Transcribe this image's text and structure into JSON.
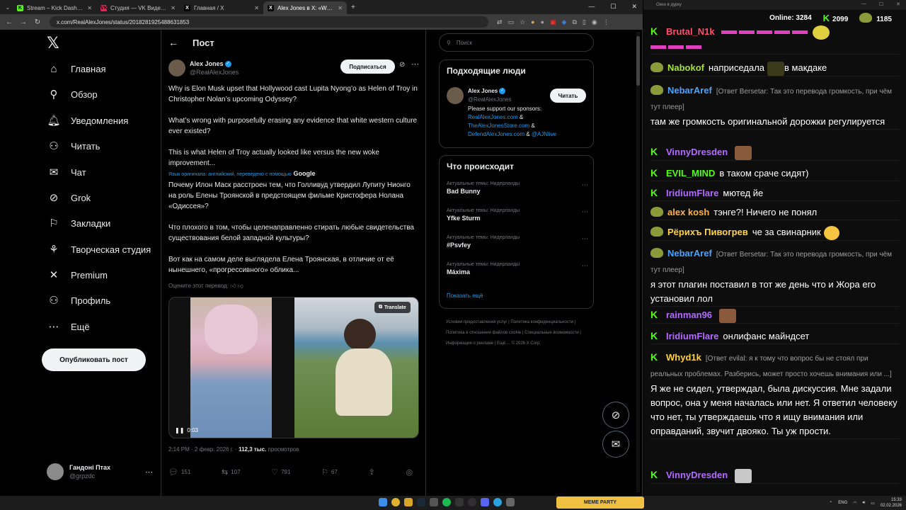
{
  "browser": {
    "tabs": [
      {
        "label": "Stream – Kick Dashboard",
        "fav": "K",
        "favcolor": "#53fc18"
      },
      {
        "label": "Студия — VK Видео Live",
        "fav": "VK",
        "favcolor": "#e0245e"
      },
      {
        "label": "Главная / X",
        "fav": "X",
        "favcolor": "#000000"
      },
      {
        "label": "Alex Jones в X: «Why is Elon M...",
        "fav": "X",
        "favcolor": "#000000"
      }
    ],
    "url": "x.com/RealAlexJones/status/2018281925488631853"
  },
  "nav": {
    "items": [
      {
        "label": "Главная",
        "icon": "⌂"
      },
      {
        "label": "Обзор",
        "icon": "⚲"
      },
      {
        "label": "Уведомления",
        "icon": "🔔︎"
      },
      {
        "label": "Читать",
        "icon": "⚇"
      },
      {
        "label": "Чат",
        "icon": "✉"
      },
      {
        "label": "Grok",
        "icon": "⊘"
      },
      {
        "label": "Закладки",
        "icon": "⚐"
      },
      {
        "label": "Творческая студия",
        "icon": "⚘"
      },
      {
        "label": "Premium",
        "icon": "✕"
      },
      {
        "label": "Профиль",
        "icon": "⚇"
      },
      {
        "label": "Ещё",
        "icon": "⋯"
      }
    ],
    "post_button": "Опубликовать пост",
    "profile_name": "Гандонi Птах",
    "profile_handle": "@grpzdc"
  },
  "post": {
    "header": "Пост",
    "author_name": "Alex Jones",
    "author_handle": "@RealAlexJones",
    "subscribe": "Подписаться",
    "text_en_1": "Why is Elon Musk upset that Hollywood cast Lupita Nyong’o as Helen of Troy in Christopher Nolan’s upcoming Odyssey?",
    "text_en_2": "What’s wrong with purposefully erasing any evidence that white western culture ever existed?",
    "text_en_3": "This is what Helen of Troy actually looked like versus the new woke improvement...",
    "translated_note": "Язык оригинала: английский, переведено с помощью",
    "translated_by": "Google",
    "text_ru_1": "Почему Илон Маск расстроен тем, что Голливуд утвердил Лупиту Нионго на роль Елены Троянской в предстоящем фильме Кристофера Нолана «Одиссея»?",
    "text_ru_2": "Что плохого в том, чтобы целенаправленно стирать любые свидетельства существования белой западной культуры?",
    "text_ru_3": "Вот как на самом деле выглядела Елена Троянская, в отличие от её нынешнего, «прогрессивного» облика...",
    "rate": "Оцените этот перевод:",
    "media_translate": "Translate",
    "media_time": "0:03",
    "time": "2:14 PM · 2 февр. 2026 г. ·",
    "views": "112,3 тыс.",
    "views_label": "просмотров",
    "replies": "151",
    "reposts": "107",
    "likes": "791",
    "bookmarks": "67"
  },
  "right": {
    "search_placeholder": "Поиск",
    "suggest_title": "Подходящие люди",
    "suggest_name": "Alex Jones",
    "suggest_handle": "@RealAlexJones",
    "suggest_bio": "Please support our sponsors:",
    "suggest_link1": "RealAlexJones.com",
    "suggest_link2": "TheAlexJonesStore.com",
    "suggest_link3": "DefendAlexJones.com",
    "suggest_link4": "@AJNlive",
    "follow": "Читать",
    "trends_title": "Что происходит",
    "trends": [
      {
        "ctx": "Актуальные темы: Нидерланды",
        "name": "Bad Bunny"
      },
      {
        "ctx": "Актуальные темы: Нидерланды",
        "name": "Yfke Sturm"
      },
      {
        "ctx": "Актуальные темы: Нидерланды",
        "name": "#Psvfey"
      },
      {
        "ctx": "Актуальные темы: Нидерланды",
        "name": "Máxima"
      }
    ],
    "show_more": "Показать ещё",
    "footer": "Условия предоставления услуг | Политика конфиденциальности | Политика в отношении файлов cookie | Специальные возможности | Информация о рекламе | Ещё ... © 2026 X Corp."
  },
  "chat": {
    "window_title": "Окно в дурку",
    "online_label": "Online:",
    "online": "3284",
    "kick_count": "2099",
    "other_count": "1185",
    "messages": [
      {
        "user": "Brutal_N1k",
        "color": "#ff4f6b",
        "text": ""
      },
      {
        "user": "Nabokof",
        "color": "#a6e22e",
        "text": "наприседала",
        "text2": "в макдаке"
      },
      {
        "user": "NebarAref",
        "color": "#4aa3ff",
        "reply": "[Ответ Bersetar: Так это перевода громкость, при чём тут плеер]",
        "text": "там же громкость оригинальной дорожки регулируется"
      },
      {
        "user": "VinnyDresden",
        "color": "#b36bff",
        "text": ""
      },
      {
        "user": "EVIL_MIND",
        "color": "#53fc18",
        "text": "в таком сраче сидят)"
      },
      {
        "user": "IridiumFlare",
        "color": "#b36bff",
        "text": "мютед йе"
      },
      {
        "user": "alex kosh",
        "color": "#ffb347",
        "text": "тэнге?! Ничего не понял"
      },
      {
        "user": "Рёрихъ Пивогрев",
        "color": "#ffd23f",
        "text": "че за свинарник"
      },
      {
        "user": "NebarAref",
        "color": "#4aa3ff",
        "reply": "[Ответ Bersetar: Так это перевода громкость, при чём тут плеер]",
        "text": "я этот плагин поставил в тот же день что и Жора его установил лол"
      },
      {
        "user": "rainman96",
        "color": "#b36bff",
        "text": ""
      },
      {
        "user": "IridiumFlare",
        "color": "#b36bff",
        "text": "онлифанс майндсет"
      },
      {
        "user": "Whyd1k",
        "color": "#ffd23f",
        "reply": "[Ответ evilal: я к тому что вопрос бы не стоял при реальных проблемах. Разберись, может просто хочешь внимания или ...]",
        "text": "Я же не сидел, утверждал, была дискуссия. Мне задали вопрос, она у меня началась или нет. Я ответил человеку что нет, ты утверждаешь что я ищу внимания или оправданий, звучит двояко. Ты уж прости."
      },
      {
        "user": "VinnyDresden",
        "color": "#b36bff",
        "text": ""
      }
    ]
  },
  "taskbar": {
    "meme_label": "MEME PARTY",
    "lang": "ENG",
    "time": "15:33",
    "date": "02.02.2026"
  }
}
